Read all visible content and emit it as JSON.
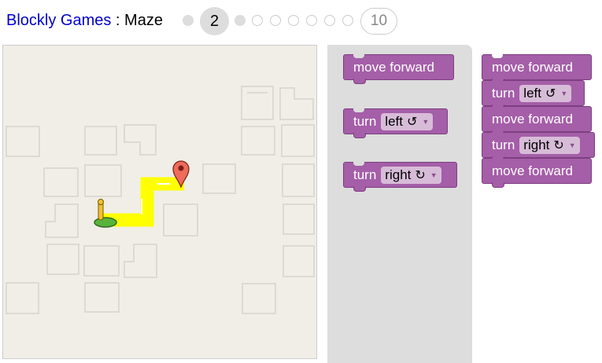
{
  "header": {
    "app_title": "Blockly Games",
    "separator": " : ",
    "game_title": "Maze",
    "current_level": "2",
    "last_level": "10"
  },
  "toolbox": {
    "blocks": [
      {
        "verb": "move forward"
      },
      {
        "verb": "turn",
        "dir": "left",
        "glyph": "↺"
      },
      {
        "verb": "turn",
        "dir": "right",
        "glyph": "↻"
      }
    ]
  },
  "workspace": {
    "blocks": [
      {
        "verb": "move forward"
      },
      {
        "verb": "turn",
        "dir": "left",
        "glyph": "↺"
      },
      {
        "verb": "move forward"
      },
      {
        "verb": "turn",
        "dir": "right",
        "glyph": "↻"
      },
      {
        "verb": "move forward"
      }
    ]
  },
  "colors": {
    "block": "#a55ea8",
    "path": "#ffff00",
    "marker": "#e74c3c",
    "link": "#0000cc"
  },
  "icons": {
    "goal": "map-marker-icon",
    "player": "pegman-icon",
    "dropdown": "triangle-down-icon"
  }
}
